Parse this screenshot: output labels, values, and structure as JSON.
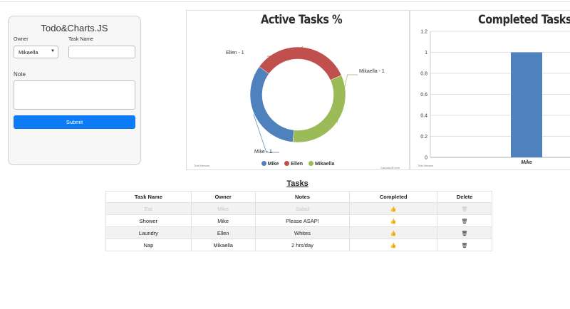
{
  "app": {
    "title": "Todo&Charts.JS",
    "owner_label": "Owner",
    "owner_value": "Mikaella",
    "task_label": "Task Name",
    "note_label": "Note",
    "submit_label": "Submit"
  },
  "donut": {
    "title": "Active Tasks %",
    "watermark_left": "Trial Version",
    "watermark_right": "CanvasJS.com",
    "labels": [
      "Ellen - 1",
      "Mikaella - 1",
      "Mike - 1"
    ],
    "legend": [
      "Mike",
      "Ellen",
      "Mikaella"
    ]
  },
  "bar": {
    "title": "Completed Tasks",
    "watermark_left": "Trial Version",
    "yticks": [
      "1.2",
      "1",
      "0.8",
      "0.6",
      "0.4",
      "0.2",
      "0"
    ],
    "category": "Mike"
  },
  "colors": {
    "blue": "#4f81bc",
    "red": "#c0504e",
    "green": "#9bbb58",
    "submit": "#0d7bf5"
  },
  "tasks": {
    "title": "Tasks",
    "headers": [
      "Task Name",
      "Owner",
      "Notes",
      "Completed",
      "Delete"
    ],
    "rows": [
      [
        "Eat",
        "Mike",
        "Salad"
      ],
      [
        "Shower",
        "Mike",
        "Please ASAP!"
      ],
      [
        "Laundry",
        "Ellen",
        "Whites"
      ],
      [
        "Nap",
        "Mikaella",
        "2 hrs/day"
      ]
    ],
    "icons": {
      "completed": "thumbs-up-icon",
      "delete": "trash-icon"
    }
  },
  "chart_data": [
    {
      "type": "pie",
      "title": "Active Tasks %",
      "categories": [
        "Mike",
        "Ellen",
        "Mikaella"
      ],
      "values": [
        1,
        1,
        1
      ],
      "colors": [
        "#4f81bc",
        "#c0504e",
        "#9bbb58"
      ],
      "legend": "bottom"
    },
    {
      "type": "bar",
      "title": "Completed Tasks",
      "categories": [
        "Mike"
      ],
      "values": [
        1
      ],
      "ylim": [
        0,
        1.2
      ],
      "yticks": [
        0,
        0.2,
        0.4,
        0.6,
        0.8,
        1,
        1.2
      ],
      "grid": true,
      "color": "#4f81bc"
    }
  ]
}
